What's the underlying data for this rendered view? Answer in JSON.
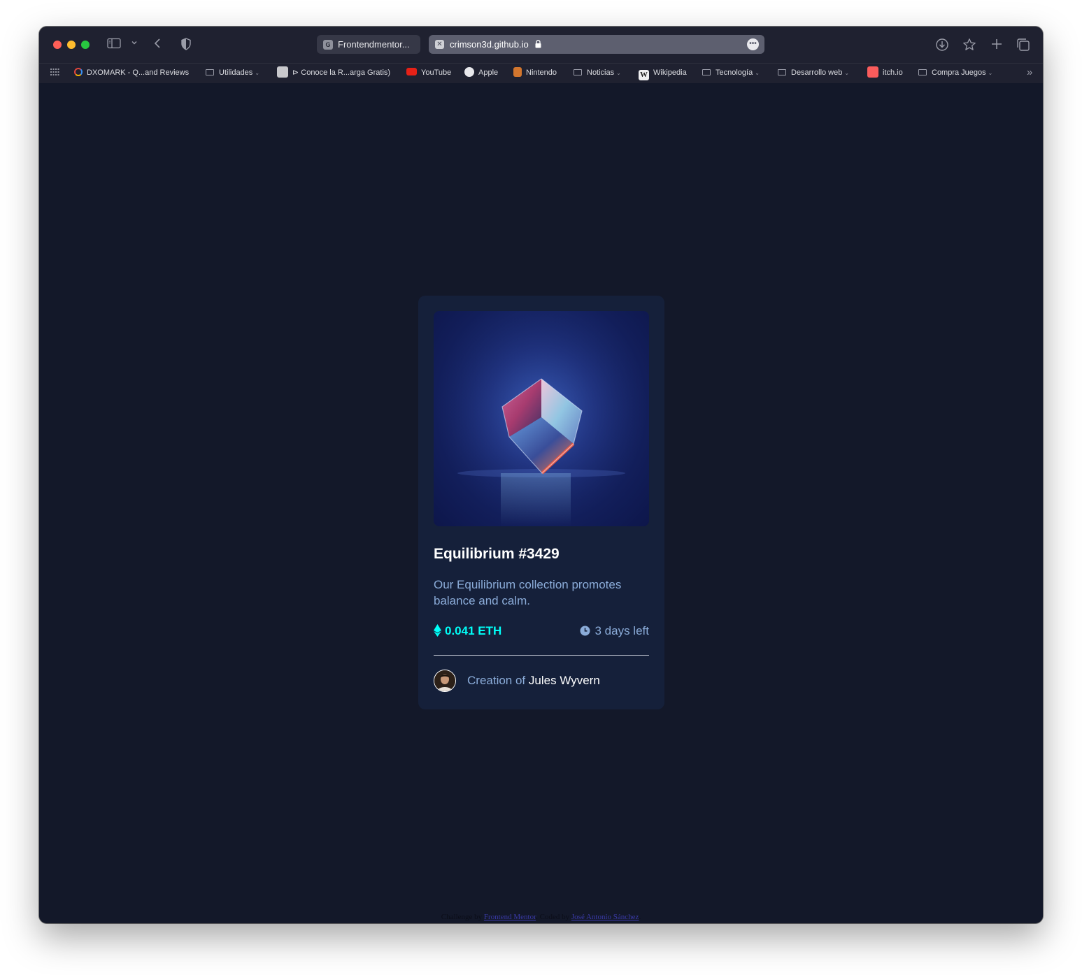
{
  "browser": {
    "tabs": [
      {
        "label": "Frontendmentor...",
        "favicon": "G",
        "active": false
      },
      {
        "label": "crimson3d.github.io",
        "favicon": "✕",
        "active": true
      }
    ],
    "icons": {
      "sidebar": "sidebar-icon",
      "back": "chevron-left-icon",
      "shield": "shield-icon",
      "download": "download-icon",
      "favorite": "star-icon",
      "new_tab": "plus-icon",
      "tabs_overview": "tabs-icon",
      "more": "more-icon"
    },
    "bookmarks": [
      {
        "label": "DXOMARK - Q...and Reviews",
        "kind": "site"
      },
      {
        "label": "Utilidades",
        "kind": "folder"
      },
      {
        "label": "⊳ Conoce la R...arga Gratis)",
        "kind": "site"
      },
      {
        "label": "YouTube",
        "kind": "site"
      },
      {
        "label": "Apple",
        "kind": "site"
      },
      {
        "label": "Nintendo",
        "kind": "site"
      },
      {
        "label": "Noticias",
        "kind": "folder"
      },
      {
        "label": "Wikipedia",
        "kind": "site"
      },
      {
        "label": "Tecnología",
        "kind": "folder"
      },
      {
        "label": "Desarrollo web",
        "kind": "folder"
      },
      {
        "label": "itch.io",
        "kind": "site"
      },
      {
        "label": "Compra Juegos",
        "kind": "folder"
      }
    ],
    "overflow_label": "»"
  },
  "card": {
    "title": "Equilibrium #3429",
    "description": "Our Equilibrium collection promotes balance and calm.",
    "price": "0.041 ETH",
    "time_left": "3 days left",
    "creator_prefix": "Creation of",
    "creator_name": "Jules Wyvern"
  },
  "footer": {
    "challenge_prefix": "Challenge by",
    "challenge_link": "Frontend Mentor",
    "coded_prefix": ". Coded by",
    "coded_link": "José Antonio Sánchez",
    "suffix": "."
  },
  "colors": {
    "page_bg": "#131829",
    "card_bg": "#15203a",
    "cyan": "#00fff8",
    "soft_blue": "#8bacd9",
    "white": "#ffffff"
  }
}
